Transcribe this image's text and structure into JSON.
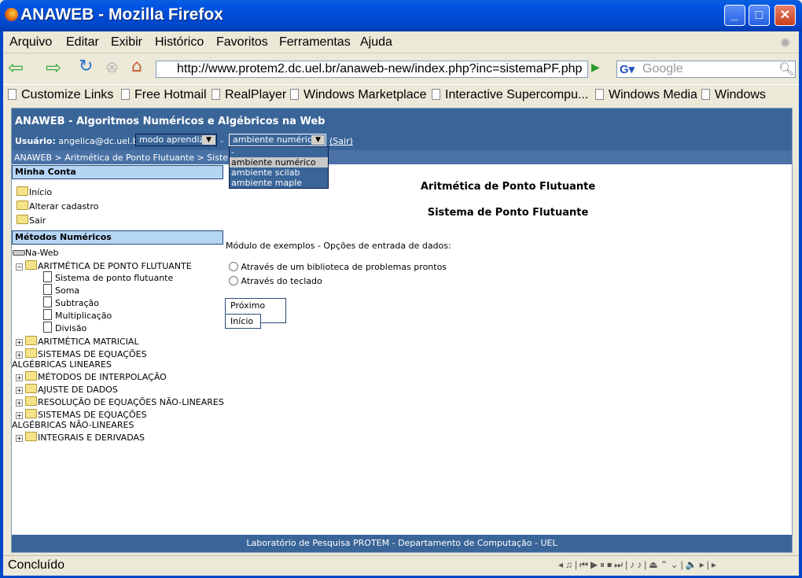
{
  "window": {
    "title": "ANAWEB - Mozilla Firefox"
  },
  "menu": [
    "Arquivo",
    "Editar",
    "Exibir",
    "Histórico",
    "Favoritos",
    "Ferramentas",
    "Ajuda"
  ],
  "url": "http://www.protem2.dc.uel.br/anaweb-new/index.php?inc=sistemaPF.php",
  "search_placeholder": "Google",
  "bookmarks": [
    "Customize Links",
    "Free Hotmail",
    "RealPlayer",
    "Windows Marketplace",
    "Interactive Supercompu...",
    "Windows Media",
    "Windows"
  ],
  "header": {
    "title": "ANAWEB - Algoritmos Numéricos e Algébricos na Web",
    "user_label": "Usuário:",
    "user": "angelica@dc.uel.br -",
    "mode": "modo aprendiz",
    "sep": "-",
    "env": "ambiente numérico",
    "logout": "(Sair)"
  },
  "env_options": [
    "-",
    "ambiente numérico",
    "ambiente scilab",
    "ambiente maple"
  ],
  "breadcrumb": "ANAWEB > Aritmética de Ponto Flutuante > Sistema de Ponto Flutuante",
  "account": {
    "title": "Minha Conta",
    "items": [
      "Início",
      "Alterar cadastro",
      "Sair"
    ]
  },
  "methods": {
    "title": "Métodos Numéricos",
    "root": "Na-Web",
    "open": "ARITMÉTICA DE PONTO FLUTUANTE",
    "children": [
      "Sistema de ponto flutuante",
      "Soma",
      "Subtração",
      "Multiplicação",
      "Divisão"
    ],
    "folders": [
      "ARITMÉTICA MATRICIAL",
      "SISTEMAS DE EQUAÇÕES ALGÉBRICAS LINEARES",
      "MÉTODOS DE INTERPOLAÇÃO",
      "AJUSTE DE DADOS",
      "RESOLUÇÃO DE EQUAÇÕES NÃO-LINEARES",
      "SISTEMAS DE EQUAÇÕES ALGÉBRICAS NÃO-LINEARES",
      "INTEGRAIS E DERIVADAS"
    ]
  },
  "main": {
    "title": "Aritmética de Ponto Flutuante",
    "subtitle": "Sistema de Ponto Flutuante",
    "prompt": "Módulo de exemplos - Opções de entrada de dados:",
    "options": [
      "Através de um biblioteca de problemas prontos",
      "Através do teclado"
    ],
    "next": "Próximo >>",
    "home": "Início"
  },
  "footer": "Laboratório de Pesquisa PROTEM - Departamento de Computação - UEL",
  "status": "Concluído"
}
